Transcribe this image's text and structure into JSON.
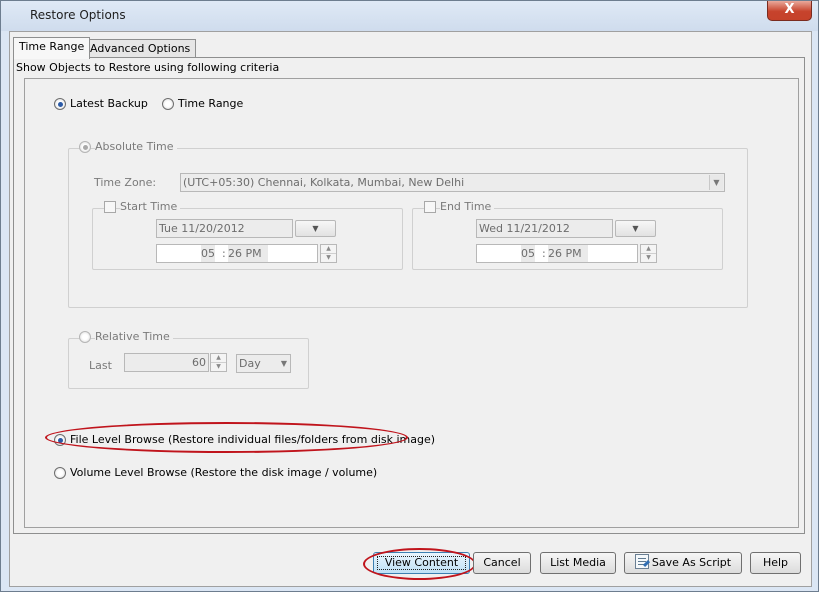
{
  "window": {
    "title": "Restore Options",
    "close_glyph": "X"
  },
  "tabs": [
    {
      "label": "Time Range",
      "active": true
    },
    {
      "label": "Advanced Options",
      "active": false
    }
  ],
  "criteria_label": "Show Objects to Restore using following criteria",
  "backup_mode": {
    "latest_backup": {
      "label": "Latest Backup",
      "checked": true
    },
    "time_range": {
      "label": "Time Range",
      "checked": false
    }
  },
  "absolute_time": {
    "label": "Absolute Time",
    "timezone_label": "Time Zone:",
    "timezone_value": "(UTC+05:30) Chennai, Kolkata, Mumbai, New Delhi",
    "start": {
      "label": "Start Time",
      "date": "Tue 11/20/2012",
      "hour": "05",
      "sep": ":",
      "minute_ampm": "26 PM"
    },
    "end": {
      "label": "End Time",
      "date": "Wed 11/21/2012",
      "hour": "05",
      "sep": ":",
      "minute_ampm": "26 PM"
    }
  },
  "relative_time": {
    "label": "Relative Time",
    "last_label": "Last",
    "last_value": "60",
    "unit": "Day"
  },
  "browse_mode": {
    "file_level": {
      "label": "File Level Browse (Restore individual files/folders from disk image)",
      "checked": true
    },
    "volume_level": {
      "label": "Volume Level Browse (Restore the disk image / volume)",
      "checked": false
    }
  },
  "buttons": {
    "view_content": "View Content",
    "cancel": "Cancel",
    "list_media": "List Media",
    "save_as_script": "Save As Script",
    "help": "Help"
  },
  "colors": {
    "highlight_oval": "#c0141c",
    "title_close": "#c7432c"
  },
  "icons": {
    "close": "close-icon",
    "dropdown": "chevron-down-icon",
    "script": "script-icon"
  }
}
